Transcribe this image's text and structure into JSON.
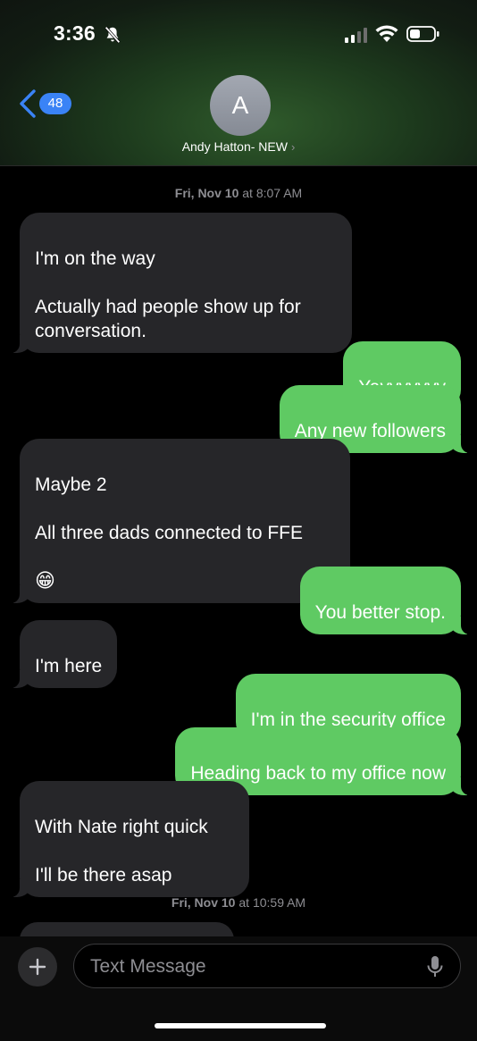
{
  "status_bar": {
    "time": "3:36",
    "icons": [
      "bell-off-icon",
      "signal-icon",
      "wifi-icon",
      "battery-icon"
    ]
  },
  "header": {
    "back_count": "48",
    "avatar_initial": "A",
    "contact_name": "Andy Hatton- NEW",
    "contact_chevron": "›"
  },
  "thread": {
    "timestamps": [
      {
        "day": "Fri, Nov 10",
        "time": " at 8:07 AM"
      },
      {
        "day": "Fri, Nov 10",
        "time": " at 10:59 AM"
      }
    ],
    "messages": [
      {
        "from": "them",
        "text": "I'm on the way\n\nActually had people show up for\nconversation."
      },
      {
        "from": "me",
        "text": "Yayyyyyyy"
      },
      {
        "from": "me",
        "text": "Any new followers"
      },
      {
        "from": "them",
        "text": "Maybe 2\n\nAll three dads connected to FFE",
        "emoji": "😁"
      },
      {
        "from": "me",
        "text": "You better stop."
      },
      {
        "from": "them",
        "text": "I'm here"
      },
      {
        "from": "me",
        "text": "I'm in the security office"
      },
      {
        "from": "me",
        "text": "Heading back to my office now"
      },
      {
        "from": "them",
        "text": "With Nate right quick\n\nI'll be there asap"
      }
    ]
  },
  "composer": {
    "placeholder": "Text Message",
    "value": ""
  },
  "colors": {
    "incoming_bubble": "#262629",
    "outgoing_bubble": "#5fca63",
    "badge": "#3a83f6",
    "timestamp": "#8e8e93"
  }
}
